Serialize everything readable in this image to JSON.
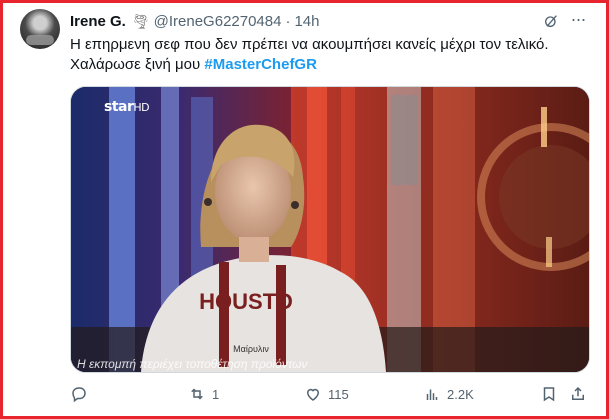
{
  "tweet": {
    "author_name": "Irene G.",
    "author_badge": "🌪",
    "handle": "@IreneG62270484",
    "separator": "·",
    "time": "14h",
    "text_line1": "Η επηρμενη σεφ  που δεν πρέπει να ακουμπήσει κανείς μέχρι τον τελικό.",
    "text_line2_plain": "Χαλάρωσε ξινή μου ",
    "hashtag": "#MasterChefGR",
    "more_glyph": "···"
  },
  "media": {
    "channel_logo_main": "star",
    "channel_logo_hd": "HD",
    "apron_text": "HOUSTO",
    "name_tag": "Μαίρυλιν",
    "caption": "Η εκπομπή περιέχει τοποθέτηση προϊόντων"
  },
  "actions": {
    "reply_count": "",
    "retweet_count": "1",
    "like_count": "115",
    "views_count": "2.2K"
  },
  "colors": {
    "accent": "#1d9bf0",
    "frame": "#e8242e",
    "muted": "#536471"
  }
}
